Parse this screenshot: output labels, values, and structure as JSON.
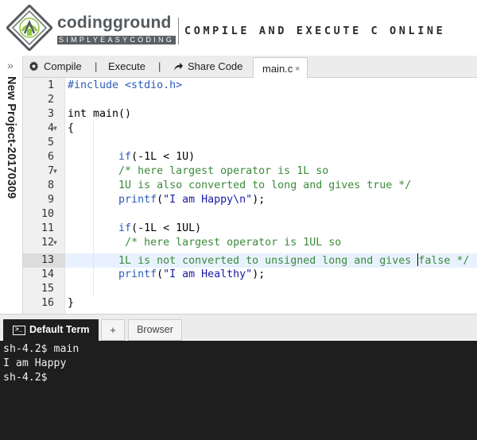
{
  "header": {
    "brand_name": "codingground",
    "brand_tagline": "SIMPLYEASYCODING",
    "title": "COMPILE AND EXECUTE C ONLINE"
  },
  "sidebar": {
    "project_name": "New Project-20170309",
    "collapse_glyph": "»"
  },
  "toolbar": {
    "compile_label": "Compile",
    "execute_label": "Execute",
    "share_label": "Share Code",
    "separator": "|"
  },
  "file_tab": {
    "label": "main.c",
    "close_glyph": "×"
  },
  "editor": {
    "line_numbers": [
      "1",
      "2",
      "3",
      "4",
      "5",
      "6",
      "7",
      "8",
      "9",
      "10",
      "11",
      "12",
      "13",
      "14",
      "15",
      "16"
    ],
    "active_line": 13
  },
  "terminal": {
    "tabs": {
      "default_term": "Default Term",
      "add": "+",
      "browser": "Browser"
    },
    "output": [
      "sh-4.2$ main",
      "I am Happy",
      "sh-4.2$"
    ]
  },
  "colors": {
    "keyword": "#2b5bb8",
    "comment": "#3b8a3b",
    "string": "#1a1aa6",
    "terminal_bg": "#1e1e1e",
    "active_line": "#e8f2fe"
  },
  "icons": [
    "logo-icon",
    "collapse-icon",
    "gear-icon",
    "share-icon",
    "close-icon",
    "terminal-icon"
  ]
}
